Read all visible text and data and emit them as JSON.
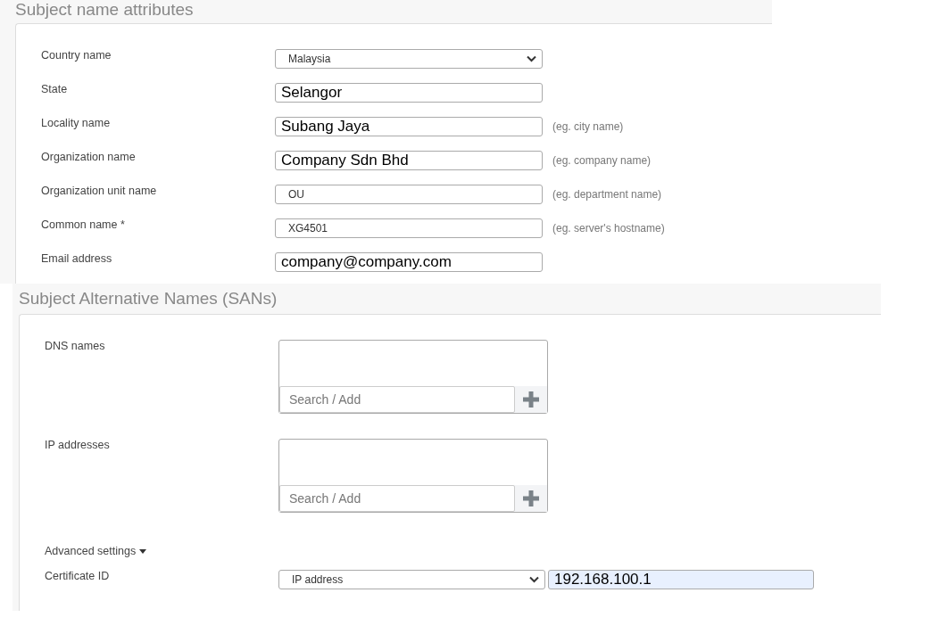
{
  "subject_section": {
    "title": "Subject name attributes",
    "fields": [
      {
        "label": "Country name",
        "kind": "select",
        "value": "Malaysia"
      },
      {
        "label": "State",
        "kind": "input",
        "value": "Selangor",
        "large": true
      },
      {
        "label": "Locality name",
        "kind": "input",
        "value": "Subang Jaya",
        "large": true,
        "hint": "(eg. city name)"
      },
      {
        "label": "Organization name",
        "kind": "input",
        "value": "Company Sdn Bhd",
        "large": true,
        "hint": "(eg. company name)"
      },
      {
        "label": "Organization unit name",
        "kind": "input",
        "value": "OU",
        "large": false,
        "hint": "(eg. department name)"
      },
      {
        "label": "Common name *",
        "kind": "input",
        "value": "XG4501",
        "large": false,
        "hint": "(eg. server's hostname)"
      },
      {
        "label": "Email address",
        "kind": "input",
        "value": "company@company.com",
        "large": true
      }
    ]
  },
  "san_section": {
    "title": "Subject Alternative Names (SANs)",
    "lists": [
      {
        "label": "DNS names",
        "placeholder": "Search / Add"
      },
      {
        "label": "IP addresses",
        "placeholder": "Search / Add"
      }
    ],
    "advanced_settings": {
      "label": "Advanced settings",
      "expanded": true
    },
    "certificate_id": {
      "label": "Certificate ID",
      "type": "IP address",
      "value": "192.168.100.1"
    }
  }
}
